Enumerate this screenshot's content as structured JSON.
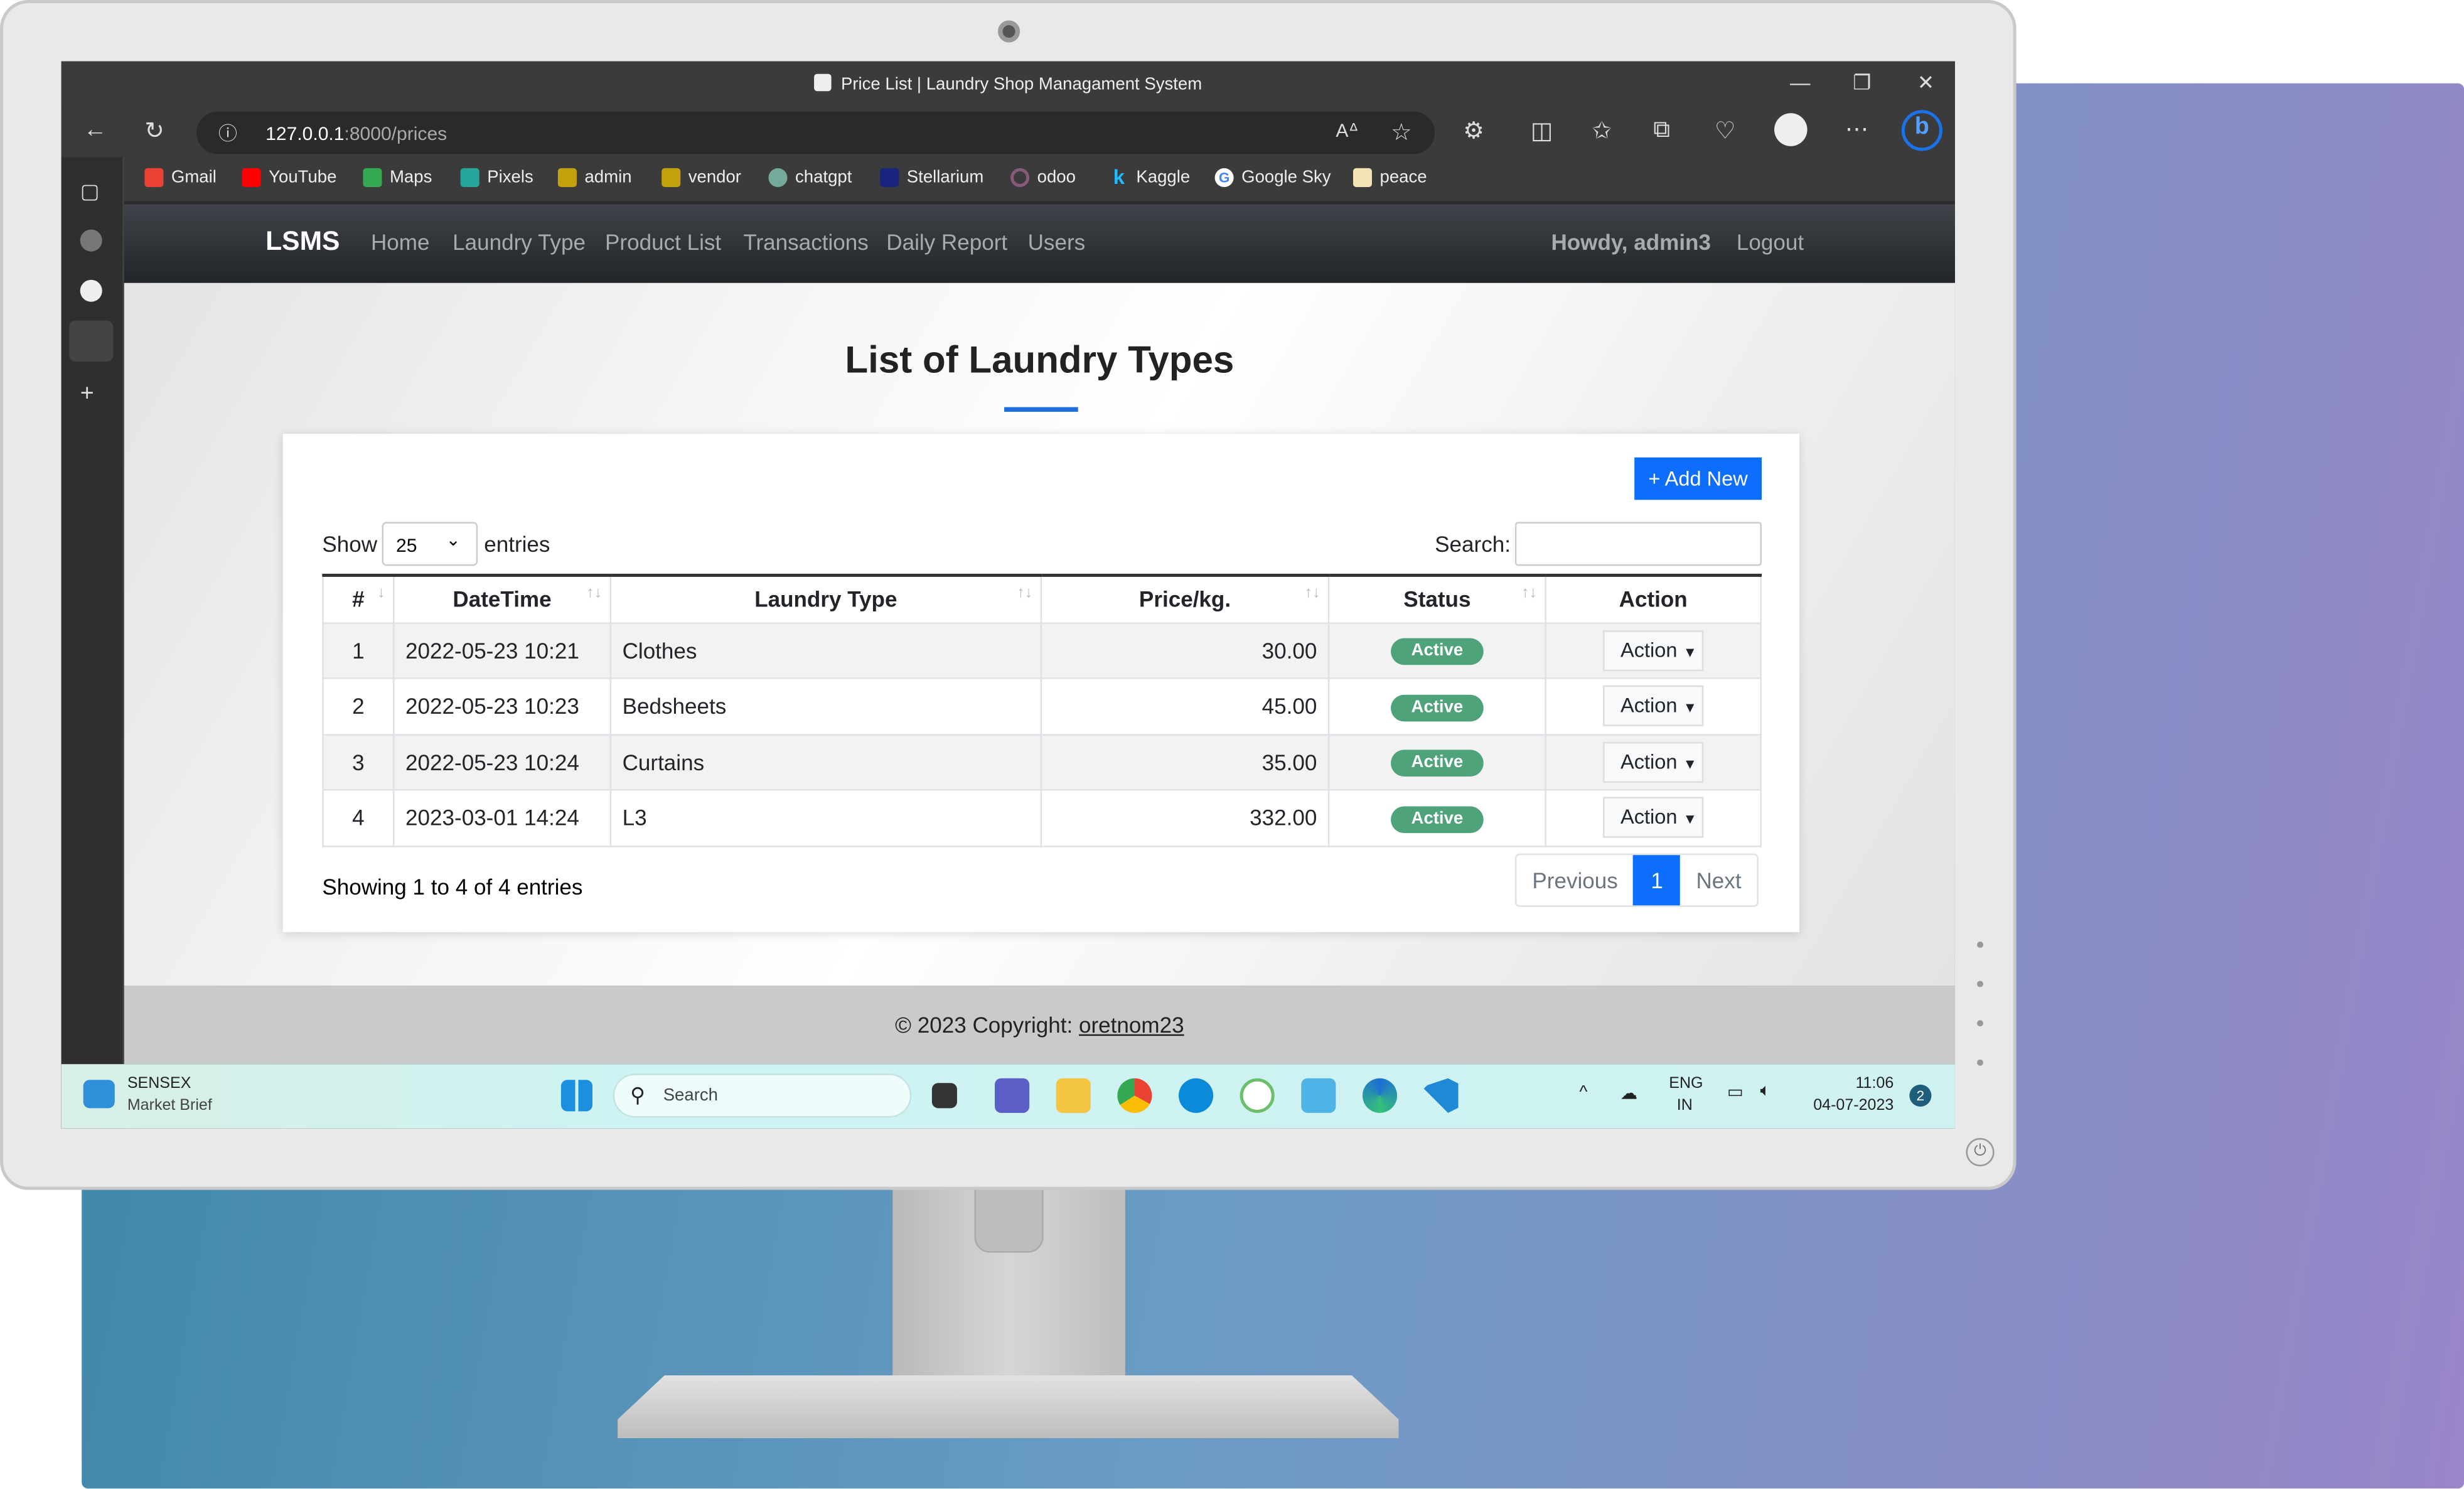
{
  "browser": {
    "tab_title": "Price List | Laundry Shop Managament System",
    "url_host": "127.0.0.1",
    "url_path": ":8000/prices",
    "bookmarks": [
      {
        "label": "Gmail",
        "icon": "gmail-icon",
        "color": "#ea4335"
      },
      {
        "label": "YouTube",
        "icon": "youtube-icon",
        "color": "#ff0000"
      },
      {
        "label": "Maps",
        "icon": "maps-icon",
        "color": "#34a853"
      },
      {
        "label": "Pixels",
        "icon": "pixels-icon",
        "color": "#26a69a"
      },
      {
        "label": "admin",
        "icon": "admin-icon",
        "color": "#c2a10c"
      },
      {
        "label": "vendor",
        "icon": "vendor-icon",
        "color": "#c2a10c"
      },
      {
        "label": "chatgpt",
        "icon": "chatgpt-icon",
        "color": "#74aa9c"
      },
      {
        "label": "Stellarium",
        "icon": "stellarium-icon",
        "color": "#1a237e"
      },
      {
        "label": "odoo",
        "icon": "odoo-icon",
        "color": "#875a7b"
      },
      {
        "label": "Kaggle",
        "icon": "kaggle-icon",
        "color": "#20beff"
      },
      {
        "label": "Google Sky",
        "icon": "google-icon",
        "color": "#4285f4"
      },
      {
        "label": "peace",
        "icon": "peace-icon",
        "color": "#e6c36b"
      }
    ]
  },
  "nav": {
    "brand": "LSMS",
    "items": [
      "Home",
      "Laundry Type",
      "Product List",
      "Transactions",
      "Daily Report",
      "Users"
    ],
    "greeting": "Howdy, admin3",
    "logout": "Logout"
  },
  "page": {
    "title": "List of Laundry Types",
    "add_new": "+ Add New",
    "show": "Show",
    "entries_value": "25",
    "entries": "entries",
    "search_label": "Search:",
    "search_value": "",
    "columns": [
      "#",
      "DateTime",
      "Laundry Type",
      "Price/kg.",
      "Status",
      "Action"
    ],
    "rows": [
      {
        "no": "1",
        "datetime": "2022-05-23 10:21",
        "type": "Clothes",
        "price": "30.00",
        "status": "Active",
        "action": "Action"
      },
      {
        "no": "2",
        "datetime": "2022-05-23 10:23",
        "type": "Bedsheets",
        "price": "45.00",
        "status": "Active",
        "action": "Action"
      },
      {
        "no": "3",
        "datetime": "2022-05-23 10:24",
        "type": "Curtains",
        "price": "35.00",
        "status": "Active",
        "action": "Action"
      },
      {
        "no": "4",
        "datetime": "2023-03-01 14:24",
        "type": "L3",
        "price": "332.00",
        "status": "Active",
        "action": "Action"
      }
    ],
    "info": "Showing 1 to 4 of 4 entries",
    "prev": "Previous",
    "current_page": "1",
    "next": "Next"
  },
  "footer": {
    "text": "© 2023 Copyright: ",
    "link": "oretnom23"
  },
  "taskbar": {
    "widget_title": "SENSEX",
    "widget_sub": "Market Brief",
    "search": "Search",
    "lang1": "ENG",
    "lang2": "IN",
    "time": "11:06",
    "date": "04-07-2023",
    "notif": "2"
  },
  "colors": {
    "accent": "#0d6efd",
    "active_badge": "#4fa37a"
  }
}
